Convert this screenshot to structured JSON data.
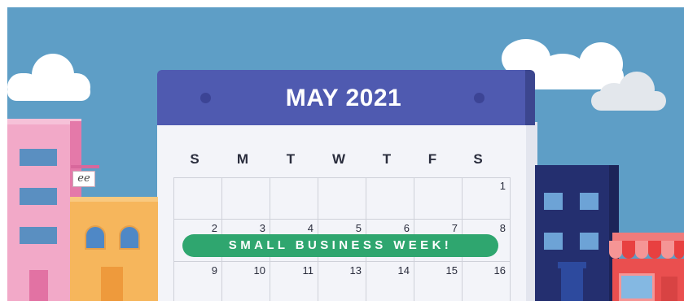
{
  "calendar": {
    "title": "MAY 2021",
    "weekdays": [
      "S",
      "M",
      "T",
      "W",
      "T",
      "F",
      "S"
    ],
    "rows": [
      [
        "",
        "",
        "",
        "",
        "",
        "",
        "1"
      ],
      [
        "2",
        "3",
        "4",
        "5",
        "6",
        "7",
        "8"
      ],
      [
        "9",
        "10",
        "11",
        "13",
        "14",
        "15",
        "16"
      ]
    ],
    "banner": "SMALL BUSINESS WEEK!"
  },
  "sign": {
    "text": "ee"
  },
  "colors": {
    "sky": "#5e9ec6",
    "header": "#4f5ab0",
    "banner": "#2fa66f",
    "pink_building": "#f2a9c8",
    "orange_building": "#f6b65c",
    "navy_building": "#242f6f",
    "shop": "#ea4f4f"
  }
}
